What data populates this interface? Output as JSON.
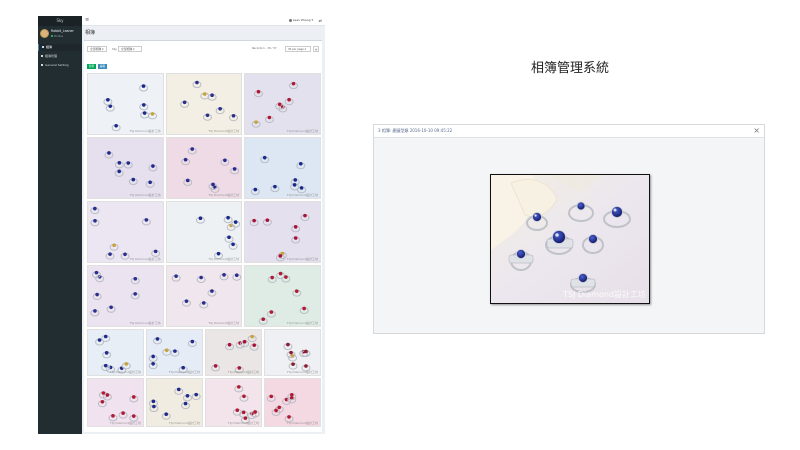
{
  "app": {
    "brand": "Sky",
    "user": {
      "name": "Rabbit_Leaner",
      "status": "Online"
    },
    "nav": [
      "相簿",
      "相簿管理",
      "General Setting"
    ],
    "top_user": "Lean Zhang",
    "page_title": "相簿"
  },
  "filters": {
    "select1": "全部相簿",
    "label2": "Sky",
    "select2": "全部相簿",
    "records": "Records 1 - 30 / 37",
    "per_page": "30 per page",
    "add": "+"
  },
  "buttons": {
    "green": "新增",
    "blue": "編輯"
  },
  "grid": {
    "watermark": "TSJ Diamond設計工坊",
    "rows": [
      [
        {
          "bg": "#eef1f6",
          "gem": "#1a2a8a"
        },
        {
          "bg": "#f3efe4",
          "gem": "#2a2f8c"
        },
        {
          "bg": "#e3e1ee",
          "gem": "#b01a34"
        }
      ],
      [
        {
          "bg": "#e6dfee",
          "gem": "#1f2a8c"
        },
        {
          "bg": "#efdbe6",
          "gem": "#2a2a90"
        },
        {
          "bg": "#dde6f3",
          "gem": "#1a2a8a"
        }
      ],
      [
        {
          "bg": "#ebe6f1",
          "gem": "#2a2f8c"
        },
        {
          "bg": "#eef1f4",
          "gem": "#1a2a8a"
        },
        {
          "bg": "#e5e0ee",
          "gem": "#a8123a"
        }
      ],
      [
        {
          "bg": "#ece3f0",
          "gem": "#2a2f8c"
        },
        {
          "bg": "#f0e6ee",
          "gem": "#2a2f8c"
        },
        {
          "bg": "#dfece6",
          "gem": "#b01a34"
        }
      ],
      [
        {
          "bg": "#e8eef6",
          "gem": "#1f2a8c"
        },
        {
          "bg": "#e6ecf6",
          "gem": "#1f2a8c"
        },
        {
          "bg": "#ebe6e6",
          "gem": "#a8123a"
        },
        {
          "bg": "#eff0f4",
          "gem": "#8a1a30"
        }
      ],
      [
        {
          "bg": "#f0e2ee",
          "gem": "#b01a34"
        },
        {
          "bg": "#f1ece2",
          "gem": "#1f2a8c"
        },
        {
          "bg": "#f2e4ea",
          "gem": "#b01a34"
        },
        {
          "bg": "#f4d8e2",
          "gem": "#b01a34"
        }
      ]
    ]
  },
  "page": {
    "title": "相簿管理系統"
  },
  "modal": {
    "caption": "3 相簿: 產圖型類 2016-10-10 09:45:22",
    "close": "×",
    "watermark": "TSJ Diamond設計工坊"
  },
  "colors": {
    "sidebar": "#222d32",
    "accent_green": "#00a65a",
    "accent_blue": "#3c8dbc",
    "sapphire": "#1a2a8a",
    "ruby": "#b01a34"
  }
}
